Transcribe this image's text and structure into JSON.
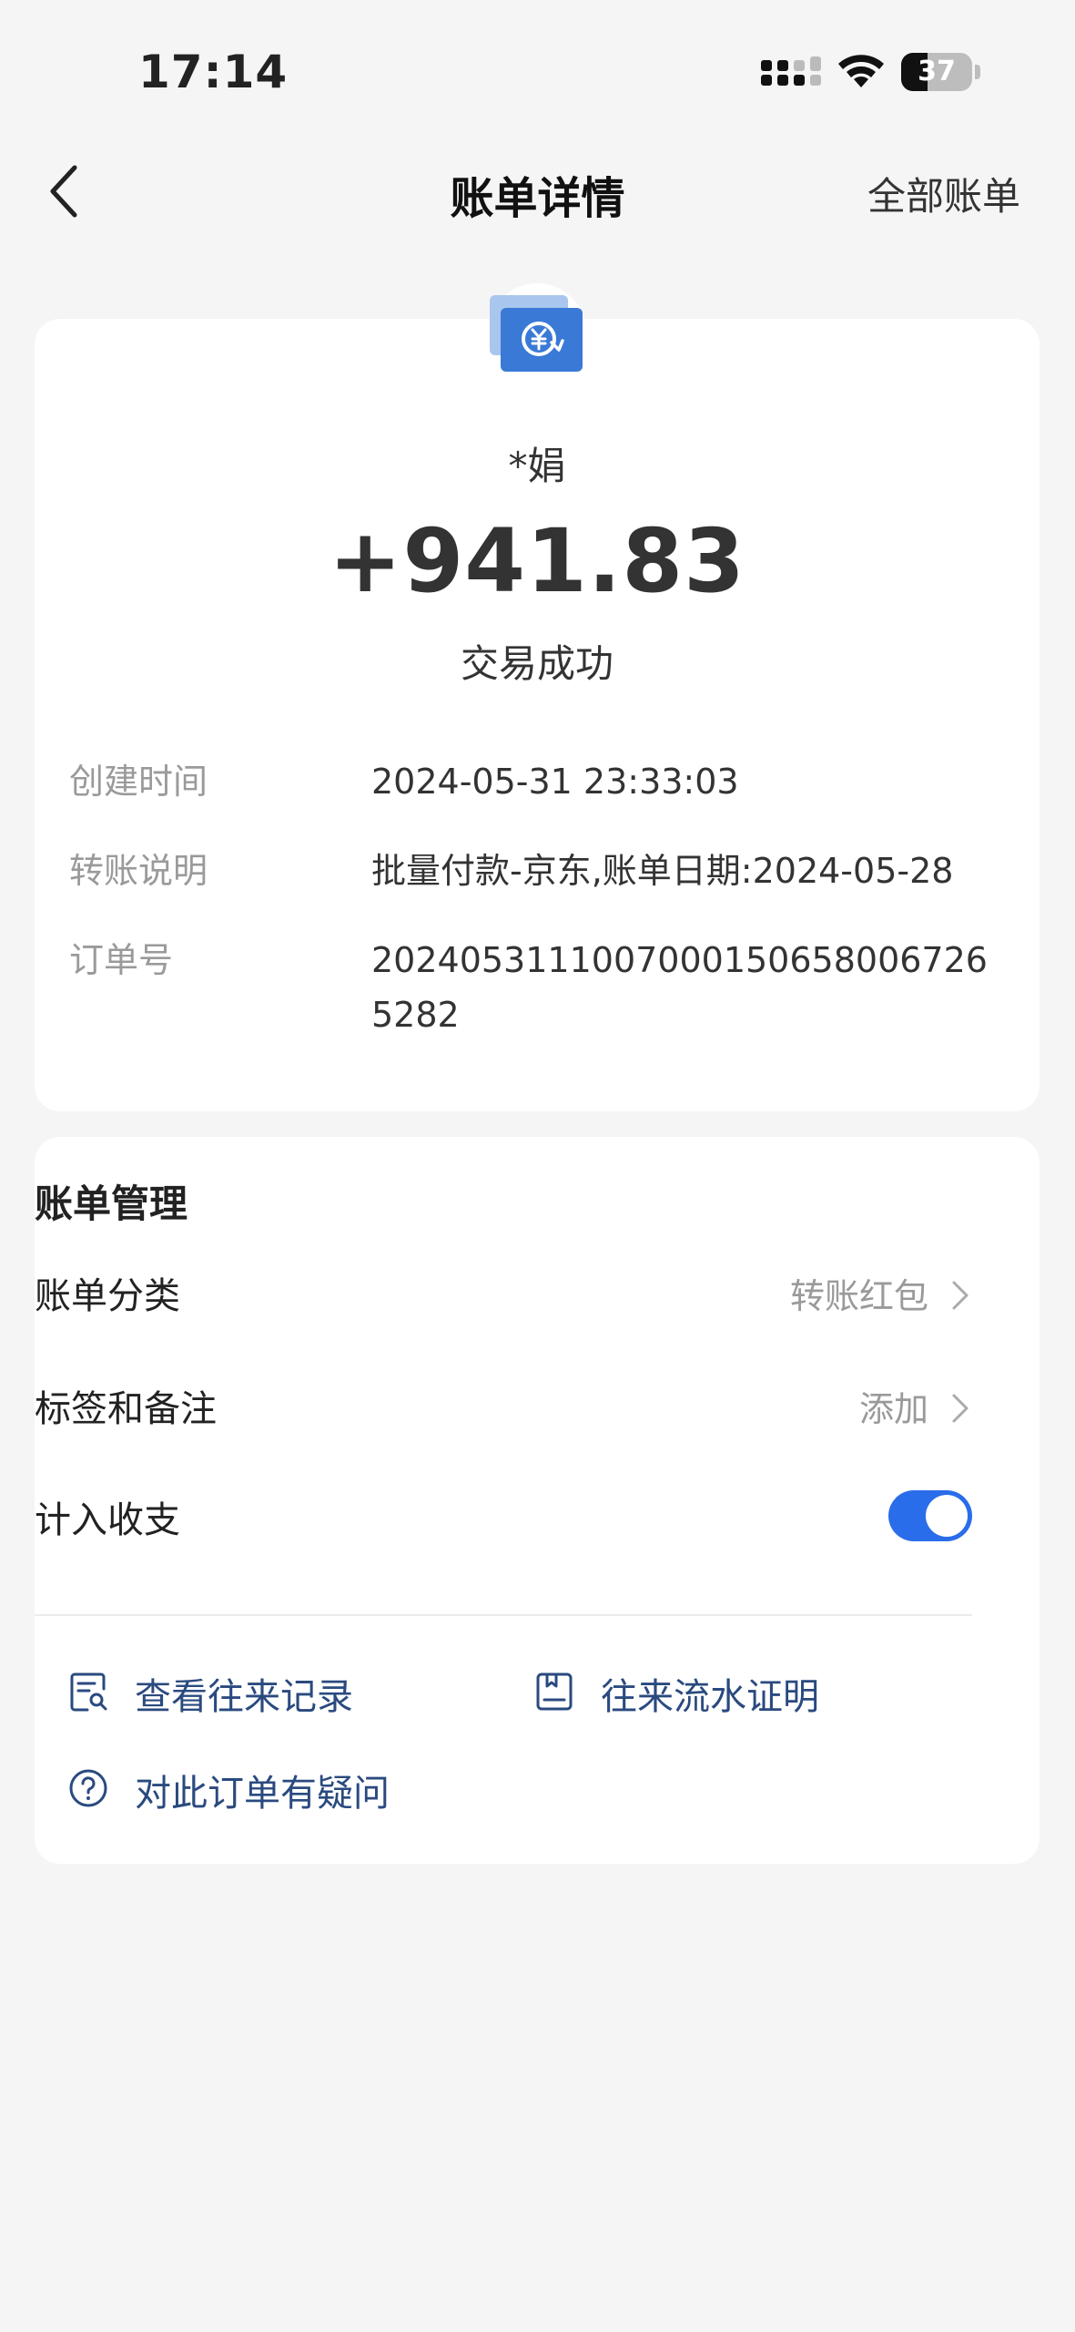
{
  "status_bar": {
    "time": "17:14",
    "battery_level": "37",
    "battery_fraction": 0.37
  },
  "nav": {
    "back_icon": "chevron-left-icon",
    "title": "账单详情",
    "right_link": "全部账单"
  },
  "transaction": {
    "icon": "transfer-yuan-icon",
    "payer": "*娟",
    "amount": "+941.83",
    "status": "交易成功",
    "details": [
      {
        "label": "创建时间",
        "value": "2024-05-31 23:33:03"
      },
      {
        "label": "转账说明",
        "value": "批量付款-京东,账单日期:2024-05-28"
      },
      {
        "label": "订单号",
        "value": "20240531110070001506580067265282"
      }
    ]
  },
  "management": {
    "title": "账单管理",
    "category": {
      "label": "账单分类",
      "value": "转账红包"
    },
    "tags": {
      "label": "标签和备注",
      "value": "添加"
    },
    "income_expense": {
      "label": "计入收支",
      "enabled": true
    },
    "links": [
      {
        "label": "查看往来记录",
        "icon": "record-search-icon"
      },
      {
        "label": "往来流水证明",
        "icon": "statement-proof-icon"
      },
      {
        "label": "对此订单有疑问",
        "icon": "question-circle-icon"
      }
    ]
  },
  "colors": {
    "accent": "#2a6dea",
    "link_text": "#2a4a7f",
    "background": "#f5f5f5"
  }
}
